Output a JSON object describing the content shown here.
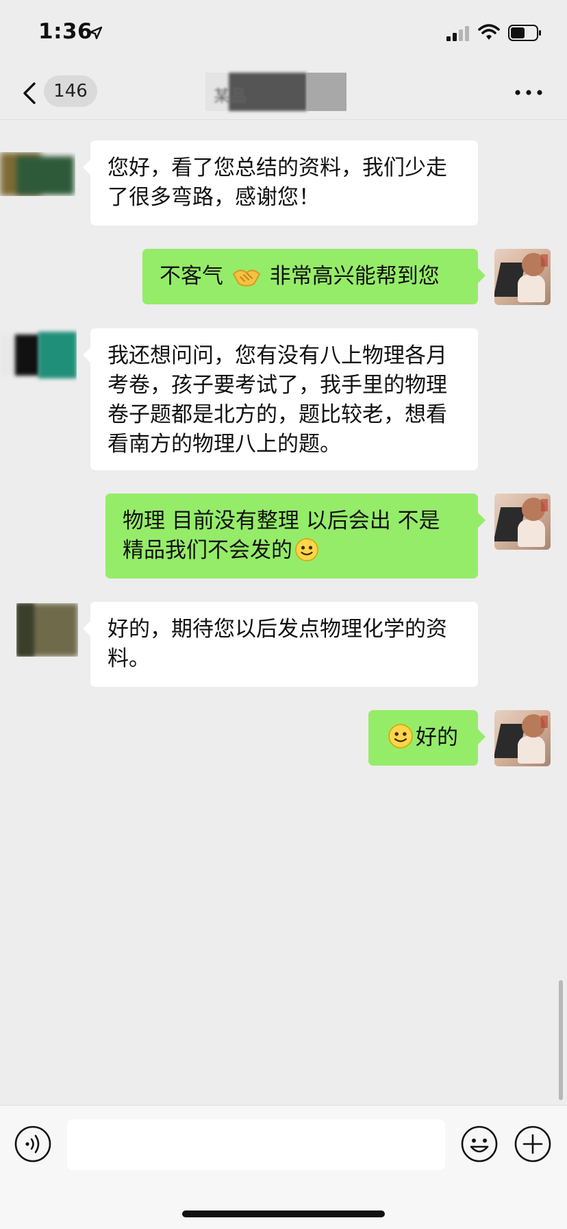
{
  "status_bar": {
    "time": "1:36",
    "icons": [
      "location-arrow-icon",
      "signal-icon",
      "wifi-icon",
      "battery-icon"
    ]
  },
  "nav": {
    "back_icon": "chevron-left-icon",
    "unread_count": "146",
    "title": "某品",
    "more_icon": "ellipsis-icon"
  },
  "messages": [
    {
      "side": "in",
      "text": "您好，看了您总结的资料，我们少走了很多弯路，感谢您！"
    },
    {
      "side": "out",
      "parts": [
        "不客气",
        "非常高兴能帮到您"
      ],
      "emoji": "handshake-emoji"
    },
    {
      "side": "in",
      "text": "我还想问问，您有没有八上物理各月考卷，孩子要考试了，我手里的物理卷子题都是北方的，题比较老，想看看南方的物理八上的题。"
    },
    {
      "side": "out",
      "text": "物理 目前没有整理  以后会出  不是精品我们不会发的",
      "emoji": "smile-emoji"
    },
    {
      "side": "in",
      "text": "好的，期待您以后发点物理化学的资料。"
    },
    {
      "side": "out",
      "text": "好的",
      "emoji": "smile-emoji"
    }
  ],
  "input_bar": {
    "voice_icon": "voice-icon",
    "text_value": "",
    "emoji_icon": "emoji-icon",
    "plus_icon": "plus-icon"
  },
  "colors": {
    "background": "#ededed",
    "bubble_in": "#ffffff",
    "bubble_out": "#95ec69",
    "badge": "#dadada"
  }
}
